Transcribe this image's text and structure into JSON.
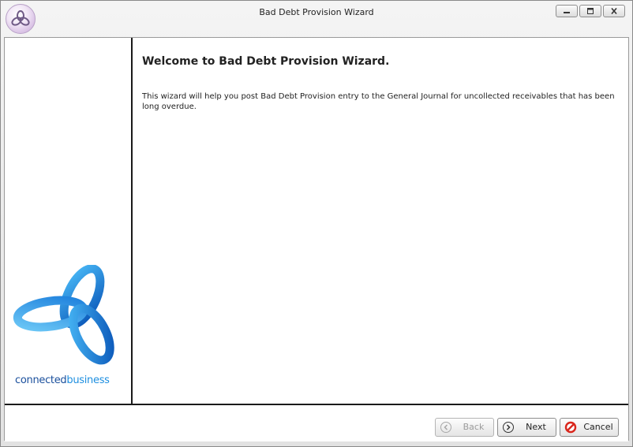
{
  "window": {
    "title": "Bad Debt Provision Wizard"
  },
  "page": {
    "heading": "Welcome to Bad Debt Provision Wizard.",
    "description": "This wizard will help you post Bad Debt Provision entry to the General Journal for uncollected receivables that has been long overdue."
  },
  "logo": {
    "part1": "connected",
    "part2": "business"
  },
  "buttons": {
    "back": "Back",
    "next": "Next",
    "cancel": "Cancel"
  },
  "colors": {
    "brand_dark": "#1a4f9c",
    "brand_light": "#1e8fe0",
    "cancel_red": "#d9261c"
  }
}
